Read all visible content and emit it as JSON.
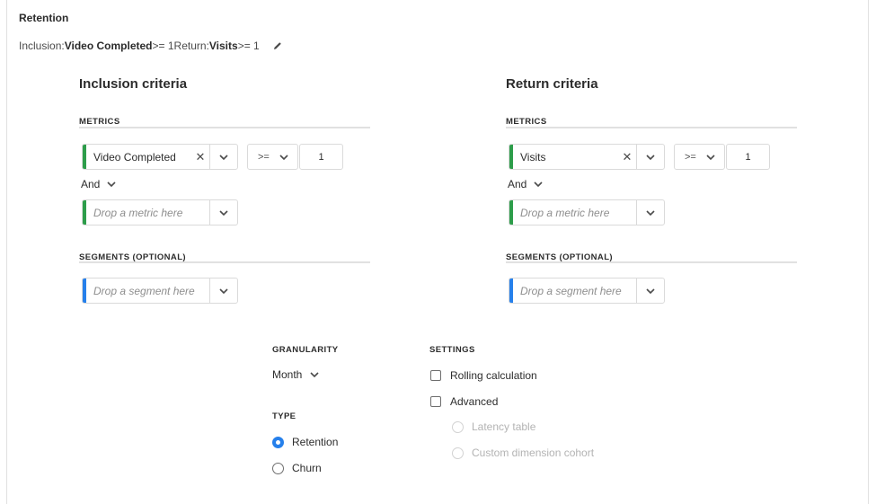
{
  "header": {
    "title": "Retention",
    "summary": {
      "inclusion_label": "Inclusion: ",
      "inclusion_metric": "Video Completed",
      "inclusion_condition": " >= 1 ",
      "return_label": "Return: ",
      "return_metric": "Visits",
      "return_condition": " >= 1"
    }
  },
  "inclusion": {
    "heading": "Inclusion criteria",
    "metrics_label": "METRICS",
    "metric": {
      "name": "Video Completed",
      "operator": ">=",
      "value": "1",
      "accent": "#2d9d4a"
    },
    "and_label": "And",
    "metric_placeholder": "Drop a metric here",
    "segments_label": "SEGMENTS (OPTIONAL)",
    "segment_placeholder": "Drop a segment here",
    "segment_accent": "#2680eb"
  },
  "return": {
    "heading": "Return criteria",
    "metrics_label": "METRICS",
    "metric": {
      "name": "Visits",
      "operator": ">=",
      "value": "1",
      "accent": "#2d9d4a"
    },
    "and_label": "And",
    "metric_placeholder": "Drop a metric here",
    "segments_label": "SEGMENTS (OPTIONAL)",
    "segment_placeholder": "Drop a segment here",
    "segment_accent": "#2680eb"
  },
  "granularity": {
    "label": "GRANULARITY",
    "value": "Month"
  },
  "type": {
    "label": "TYPE",
    "options": [
      {
        "label": "Retention",
        "selected": true
      },
      {
        "label": "Churn",
        "selected": false
      }
    ]
  },
  "settings": {
    "label": "SETTINGS",
    "rolling": {
      "label": "Rolling calculation",
      "checked": false
    },
    "advanced": {
      "label": "Advanced",
      "checked": false
    },
    "latency": {
      "label": "Latency table",
      "disabled": true
    },
    "custom_cohort": {
      "label": "Custom dimension cohort",
      "disabled": true
    }
  },
  "icons": {
    "edit": "pencil-icon",
    "clear": "close-icon",
    "chevron": "chevron-down-icon"
  }
}
